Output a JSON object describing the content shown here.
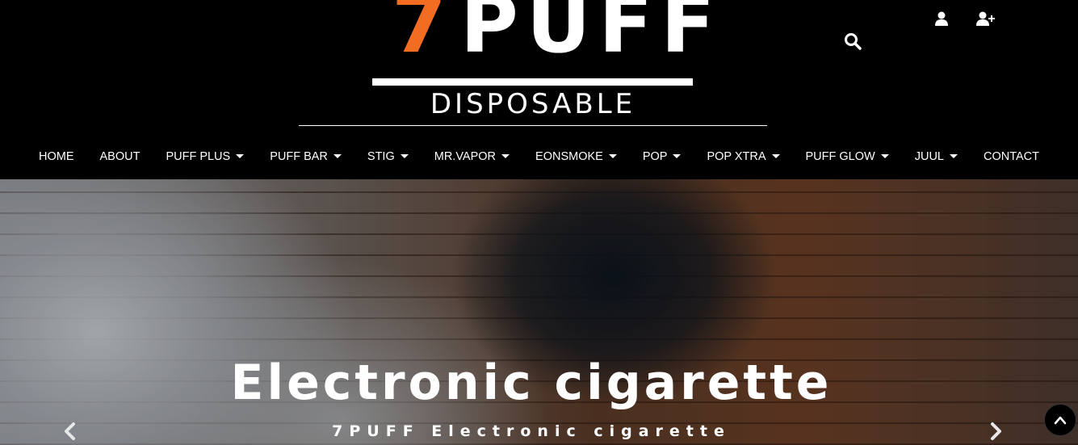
{
  "logo": {
    "number": "7",
    "word": "PUFF",
    "subtitle": "DISPOSABLE",
    "accent_color": "#f26d21"
  },
  "header_icons": [
    "search-icon",
    "user-icon",
    "user-plus-icon"
  ],
  "nav": {
    "items": [
      {
        "label": "HOME",
        "dropdown": false
      },
      {
        "label": "ABOUT",
        "dropdown": false
      },
      {
        "label": "PUFF PLUS",
        "dropdown": true
      },
      {
        "label": "PUFF BAR",
        "dropdown": true
      },
      {
        "label": "STIG",
        "dropdown": true
      },
      {
        "label": "MR.VAPOR",
        "dropdown": true
      },
      {
        "label": "EONSMOKE",
        "dropdown": true
      },
      {
        "label": "POP",
        "dropdown": true
      },
      {
        "label": "POP XTRA",
        "dropdown": true
      },
      {
        "label": "PUFF GLOW",
        "dropdown": true
      },
      {
        "label": "JUUL",
        "dropdown": true
      },
      {
        "label": "CONTACT",
        "dropdown": false
      }
    ]
  },
  "hero": {
    "title": "Electronic cigarette",
    "subtitle": "7PUFF Electronic cigarette"
  },
  "carousel_controls": [
    "chevron-left-icon",
    "chevron-right-icon"
  ],
  "scroll_top_icon": "chevron-up-icon"
}
